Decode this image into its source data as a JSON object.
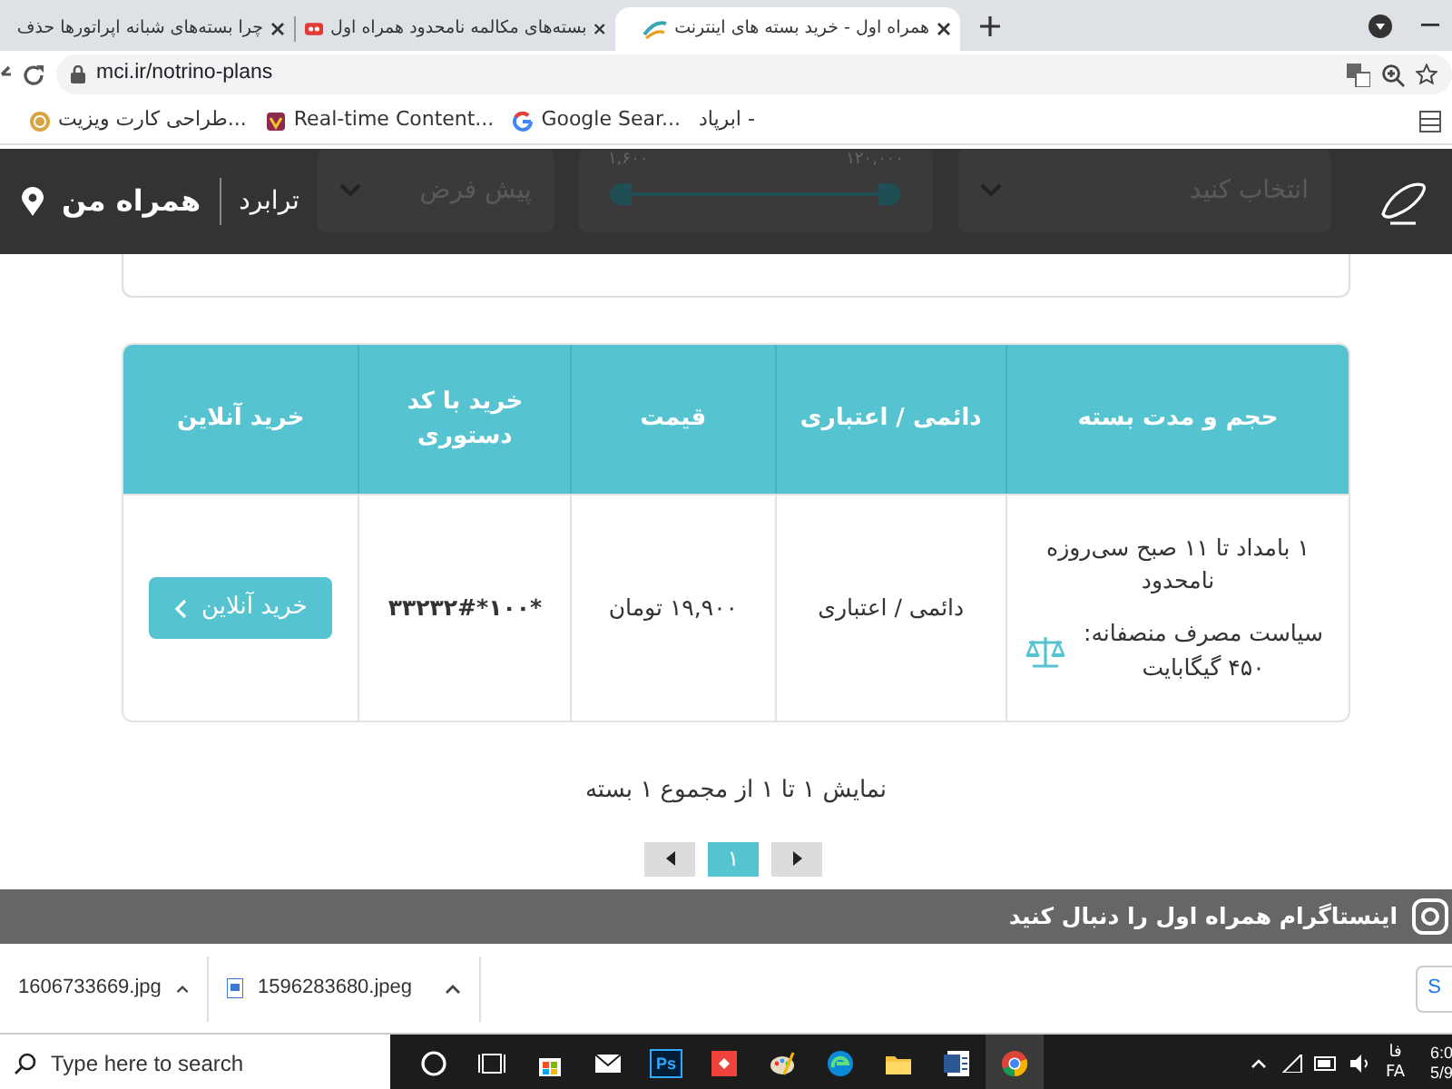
{
  "browser": {
    "tabs": [
      {
        "title": "همراه اول - خرید بسته های اینترنت",
        "selected": true
      },
      {
        "title": "بسته‌های مکالمه نامحدود همراه اول",
        "selected": false
      },
      {
        "title": "چرا بسته‌های شبانه اپراتورها حذف",
        "selected": false
      }
    ],
    "url": "mci.ir/notrino-plans",
    "bookmarks": [
      {
        "title": "ابرپاد -"
      },
      {
        "title": "Google Sear..."
      },
      {
        "title": "Real-time Content..."
      },
      {
        "title": "طراحی کارت ویزیت..."
      }
    ]
  },
  "site_header": {
    "link": "ترابرد",
    "my_logo": "همراه من",
    "filters": {
      "select_placeholder": "انتخاب کنید",
      "range_max": "۱۲۰,۰۰۰",
      "range_min": "۱,۶۰۰",
      "range": {
        "level": 1
      },
      "sort": "پیش فرض"
    }
  },
  "table": {
    "columns": [
      "حجم و مدت بسته",
      "دائمی / اعتباری",
      "قیمت",
      "خرید با کد دستوری",
      "خرید آنلاین"
    ],
    "rows": [
      {
        "volume": "۱ بامداد تا ۱۱ صبح سی‌روزه نامحدود",
        "policy": "سیاست مصرف منصفانه: ۴۵۰ گیگابایت",
        "type": "دائمی / اعتباری",
        "price": "۱۹,۹۰۰ تومان",
        "code": "*۱۰۰*۳۳۲۳۲#",
        "buy": "خرید آنلاین"
      }
    ]
  },
  "summary": "نمایش ۱ تا ۱ از مجموع ۱ بسته",
  "pagination": [
    {
      "label": "۱",
      "selected": true
    }
  ],
  "instagram_bar": "اینستاگرام همراه اول را دنبال کنید",
  "downloads": {
    "files": [
      {
        "name": "1596283680.jpeg"
      },
      {
        "name": "1606733669.jpg"
      }
    ],
    "show_all": "S"
  },
  "taskbar": {
    "search_placeholder": "Type here to search",
    "ps_label": "Ps",
    "language": [
      "فا",
      "FA"
    ],
    "time": "6:0",
    "date": "5/9"
  }
}
